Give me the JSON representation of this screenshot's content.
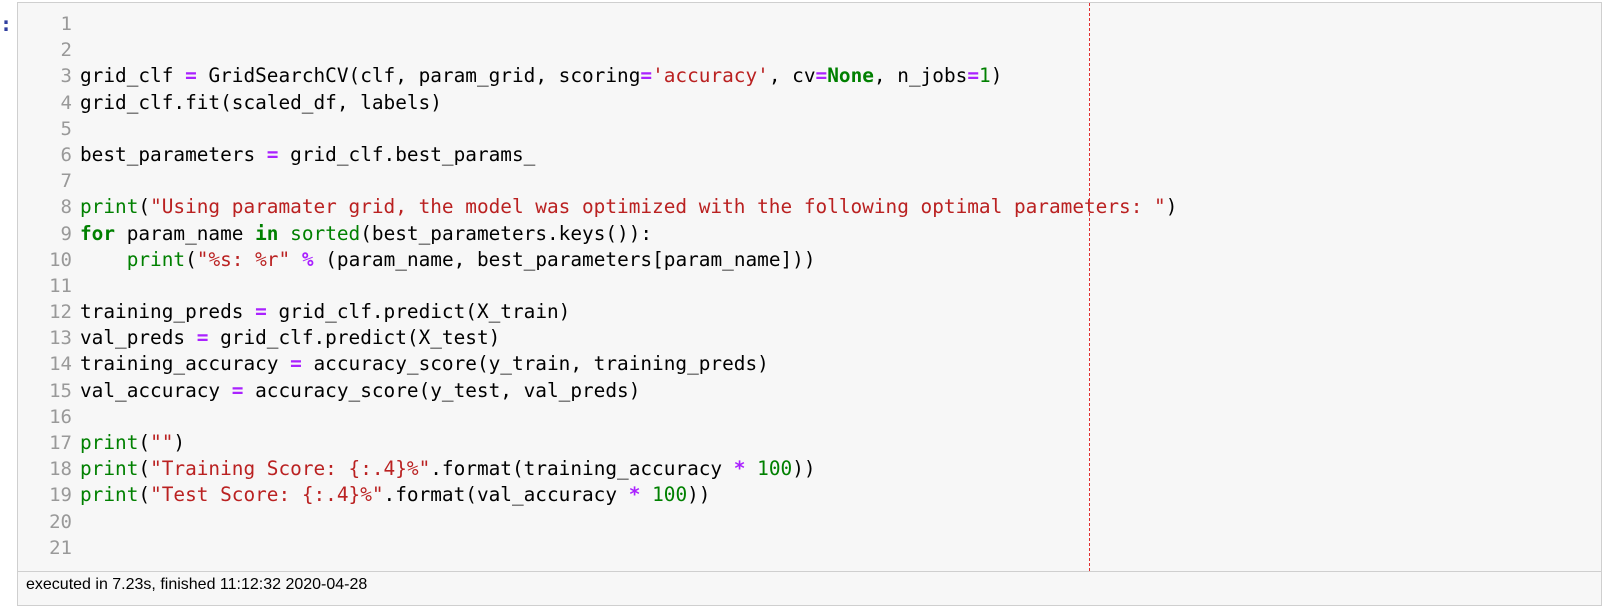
{
  "cell": {
    "prompt": ":",
    "line_numbers": [
      "1",
      "2",
      "3",
      "4",
      "5",
      "6",
      "7",
      "8",
      "9",
      "10",
      "11",
      "12",
      "13",
      "14",
      "15",
      "16",
      "17",
      "18",
      "19",
      "20",
      "21"
    ],
    "lines": [
      [],
      [],
      [
        [
          "t",
          "grid_clf "
        ],
        [
          "op",
          "="
        ],
        [
          "t",
          " GridSearchCV(clf, param_grid, scoring"
        ],
        [
          "op",
          "="
        ],
        [
          "str",
          "'accuracy'"
        ],
        [
          "t",
          ", cv"
        ],
        [
          "op",
          "="
        ],
        [
          "const",
          "None"
        ],
        [
          "t",
          ", n_jobs"
        ],
        [
          "op",
          "="
        ],
        [
          "num",
          "1"
        ],
        [
          "t",
          ")"
        ]
      ],
      [
        [
          "t",
          "grid_clf.fit(scaled_df, labels)"
        ]
      ],
      [],
      [
        [
          "t",
          "best_parameters "
        ],
        [
          "op",
          "="
        ],
        [
          "t",
          " grid_clf.best_params_"
        ]
      ],
      [],
      [
        [
          "bi",
          "print"
        ],
        [
          "t",
          "("
        ],
        [
          "str",
          "\"Using paramater grid, the model was optimized with the following optimal parameters: \""
        ],
        [
          "t",
          ")"
        ]
      ],
      [
        [
          "kw",
          "for"
        ],
        [
          "t",
          " param_name "
        ],
        [
          "kw",
          "in"
        ],
        [
          "t",
          " "
        ],
        [
          "bi",
          "sorted"
        ],
        [
          "t",
          "(best_parameters.keys()):"
        ]
      ],
      [
        [
          "t",
          "    "
        ],
        [
          "bi",
          "print"
        ],
        [
          "t",
          "("
        ],
        [
          "str",
          "\"%s: %r\""
        ],
        [
          "t",
          " "
        ],
        [
          "op",
          "%"
        ],
        [
          "t",
          " (param_name, best_parameters[param_name]))"
        ]
      ],
      [],
      [
        [
          "t",
          "training_preds "
        ],
        [
          "op",
          "="
        ],
        [
          "t",
          " grid_clf.predict(X_train)"
        ]
      ],
      [
        [
          "t",
          "val_preds "
        ],
        [
          "op",
          "="
        ],
        [
          "t",
          " grid_clf.predict(X_test)"
        ]
      ],
      [
        [
          "t",
          "training_accuracy "
        ],
        [
          "op",
          "="
        ],
        [
          "t",
          " accuracy_score(y_train, training_preds)"
        ]
      ],
      [
        [
          "t",
          "val_accuracy "
        ],
        [
          "op",
          "="
        ],
        [
          "t",
          " accuracy_score(y_test, val_preds)"
        ]
      ],
      [],
      [
        [
          "bi",
          "print"
        ],
        [
          "t",
          "("
        ],
        [
          "str",
          "\"\""
        ],
        [
          "t",
          ")"
        ]
      ],
      [
        [
          "bi",
          "print"
        ],
        [
          "t",
          "("
        ],
        [
          "str",
          "\"Training Score: {:.4}%\""
        ],
        [
          "t",
          ".format(training_accuracy "
        ],
        [
          "op",
          "*"
        ],
        [
          "t",
          " "
        ],
        [
          "num",
          "100"
        ],
        [
          "t",
          "))"
        ]
      ],
      [
        [
          "bi",
          "print"
        ],
        [
          "t",
          "("
        ],
        [
          "str",
          "\"Test Score: {:.4}%\""
        ],
        [
          "t",
          ".format(val_accuracy "
        ],
        [
          "op",
          "*"
        ],
        [
          "t",
          " "
        ],
        [
          "num",
          "100"
        ],
        [
          "t",
          "))"
        ]
      ],
      [],
      []
    ],
    "execution_info": "executed in 7.23s, finished 11:12:32 2020-04-28"
  }
}
